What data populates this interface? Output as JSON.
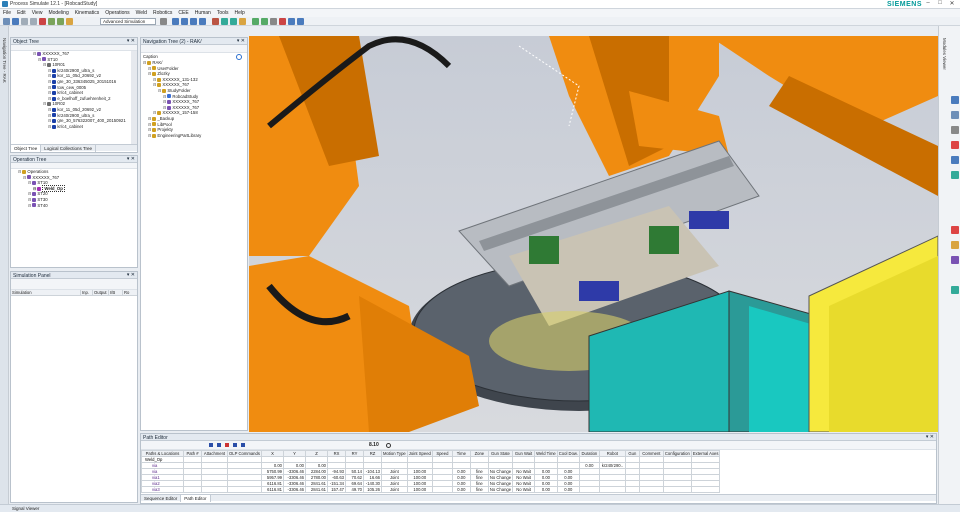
{
  "window": {
    "title": "Process Simulate 12.1 - [RobcadStudy]",
    "brand": "SIEMENS"
  },
  "menu": [
    "File",
    "Edit",
    "View",
    "Modeling",
    "Kinematics",
    "Operations",
    "Weld",
    "Robotics",
    "CEE",
    "Human",
    "Tools",
    "Help"
  ],
  "toolbar": {
    "study_dropdown": "Advanced Simulation"
  },
  "left_strip": {
    "label": "Navigation Tree - RAK"
  },
  "right_strip": {
    "label": "Modules Viewer"
  },
  "object_tree": {
    "title": "Object Tree",
    "tabs": [
      "Object Tree",
      "Logical Collections Tree"
    ],
    "rows": [
      {
        "d": 4,
        "t": "XXXXXX_767",
        "c": "#7a52b3"
      },
      {
        "d": 5,
        "t": "ST10",
        "c": "#7a52b3"
      },
      {
        "d": 6,
        "t": "10R01",
        "c": "#6b6b6b"
      },
      {
        "d": 7,
        "t": "kr240r2900_ultra_s",
        "c": "#1a3fa8"
      },
      {
        "d": 7,
        "t": "kor_11_05d_20692_v2",
        "c": "#1a3fa8"
      },
      {
        "d": 7,
        "t": "gre_30_336345025_20151016",
        "c": "#1a3fa8"
      },
      {
        "d": 7,
        "t": "tow_cew_0005",
        "c": "#1a3fa8"
      },
      {
        "d": 7,
        "t": "kr/c4_cabinet",
        "c": "#1a3fa8"
      },
      {
        "d": 7,
        "t": "e_boelhoff_zufuehrenheit_2",
        "c": "#1a3fa8"
      },
      {
        "d": 6,
        "t": "10R02",
        "c": "#6b6b6b"
      },
      {
        "d": 7,
        "t": "kor_11_05d_20692_v2",
        "c": "#1a3fa8"
      },
      {
        "d": 7,
        "t": "kr240r2900_ultra_s",
        "c": "#1a3fa8"
      },
      {
        "d": 7,
        "t": "gre_30_576322007_400_20150921",
        "c": "#1a3fa8"
      },
      {
        "d": 7,
        "t": "kr/c4_cabinet",
        "c": "#1a3fa8"
      }
    ]
  },
  "operation_tree": {
    "title": "Operation Tree",
    "rows": [
      {
        "d": 1,
        "t": "Operations",
        "c": "#d0a020"
      },
      {
        "d": 2,
        "t": "XXXXXX_767",
        "c": "#7a52b3"
      },
      {
        "d": 3,
        "t": "ST10",
        "c": "#7a52b3"
      },
      {
        "d": 4,
        "t": "Weld_Op",
        "c": "#a22bb5",
        "sel": true
      },
      {
        "d": 3,
        "t": "ST20",
        "c": "#7a52b3"
      },
      {
        "d": 3,
        "t": "ST30",
        "c": "#7a52b3"
      },
      {
        "d": 3,
        "t": "ST40",
        "c": "#7a52b3"
      }
    ]
  },
  "simulation_panel": {
    "title": "Simulation Panel",
    "columns": [
      "Simulation",
      "Inp.",
      "Output",
      "I/B",
      "Ro"
    ]
  },
  "nav_tree": {
    "title": "Navigation Tree (2) - RAK/",
    "search_label": "Caption",
    "rows": [
      {
        "d": 0,
        "t": "RAK/",
        "c": "#d0a020"
      },
      {
        "d": 1,
        "t": "UserFolder",
        "c": "#d0a020"
      },
      {
        "d": 1,
        "t": "Zlozky",
        "c": "#d0a020"
      },
      {
        "d": 2,
        "t": "XXXXXX_131-132",
        "c": "#d0a020"
      },
      {
        "d": 2,
        "t": "XXXXXX_767",
        "c": "#d0a020"
      },
      {
        "d": 3,
        "t": "StudyFolder",
        "c": "#d0a020"
      },
      {
        "d": 4,
        "t": "RobcadStudy",
        "c": "#3a6fd6"
      },
      {
        "d": 4,
        "t": "XXXXXX_767",
        "c": "#7a52b3"
      },
      {
        "d": 4,
        "t": "XXXXXX_767",
        "c": "#7a52b3"
      },
      {
        "d": 2,
        "t": "XXXXXX_157-158",
        "c": "#d0a020"
      },
      {
        "d": 1,
        "t": "_Backup",
        "c": "#d0a020"
      },
      {
        "d": 1,
        "t": "LibPool",
        "c": "#d0a020"
      },
      {
        "d": 1,
        "t": "Projekty",
        "c": "#d0a020"
      },
      {
        "d": 1,
        "t": "EngineeringPartLibrary",
        "c": "#d0a020"
      }
    ]
  },
  "path_editor": {
    "title": "Path Editor",
    "time": "8.10",
    "columns": [
      "Paths & Locations",
      "Path #",
      "Attachment",
      "OLP Commands",
      "X",
      "Y",
      "Z",
      "RX",
      "RY",
      "RZ",
      "Motion Type",
      "Joint Speed",
      "Speed",
      "Time",
      "Zone",
      "Gun State",
      "Gun Wait",
      "Weld Time",
      "Cool Dow.",
      "Duration",
      "Robot",
      "Gun",
      "Comment",
      "Configuration",
      "External Axes"
    ],
    "rows": [
      [
        "Weld_Op",
        "",
        "",
        "",
        "",
        "",
        "",
        "",
        "",
        "",
        "",
        "",
        "",
        "",
        "",
        "",
        "",
        "",
        "",
        "",
        "",
        "",
        "",
        "",
        ""
      ],
      [
        "via",
        "",
        "",
        "",
        "0.00",
        "0.00",
        "0.00",
        "",
        "",
        "",
        "",
        "",
        "",
        "",
        "",
        "",
        "",
        "",
        "",
        "0.00",
        "kr240r290..",
        "",
        "",
        "",
        ""
      ],
      [
        "via",
        "",
        "",
        "",
        "5750.99",
        "-3306.46",
        "2284.00",
        "-94.93",
        "50.14",
        "-104.13",
        "Joint",
        "100.00",
        "",
        "0.00",
        "fine",
        "No Change",
        "No Wait",
        "0.00",
        "0.00",
        "",
        "",
        "",
        "",
        "",
        ""
      ],
      [
        "via1",
        "",
        "",
        "",
        "5957.99",
        "-3306.46",
        "2780.00",
        "-60.63",
        "70.62",
        "16.66",
        "Joint",
        "100.00",
        "",
        "0.00",
        "fine",
        "No Change",
        "No Wait",
        "0.00",
        "0.00",
        "",
        "",
        "",
        "",
        "",
        ""
      ],
      [
        "via2",
        "",
        "",
        "",
        "6116.81",
        "-3306.46",
        "2841.61",
        "-151.34",
        "69.64",
        "-140.30",
        "Joint",
        "100.00",
        "",
        "0.00",
        "fine",
        "No Change",
        "No Wait",
        "0.00",
        "0.00",
        "",
        "",
        "",
        "",
        "",
        ""
      ],
      [
        "via3",
        "",
        "",
        "",
        "6116.81",
        "-3306.46",
        "2841.61",
        "157.47",
        "49.70",
        "105.26",
        "Joint",
        "100.00",
        "",
        "0.00",
        "fine",
        "No Change",
        "No Wait",
        "0.00",
        "0.00",
        "",
        "",
        "",
        "",
        "",
        ""
      ]
    ],
    "tabs": [
      "Sequence Editor",
      "Path Editor"
    ]
  },
  "status": {
    "text": "Signal Viewer"
  },
  "colors": {
    "robot": "#f08c10",
    "robot_dark": "#c96e00",
    "teal": "#1fb8b3",
    "yellow": "#f6e93d",
    "blue": "#2b58c2"
  }
}
